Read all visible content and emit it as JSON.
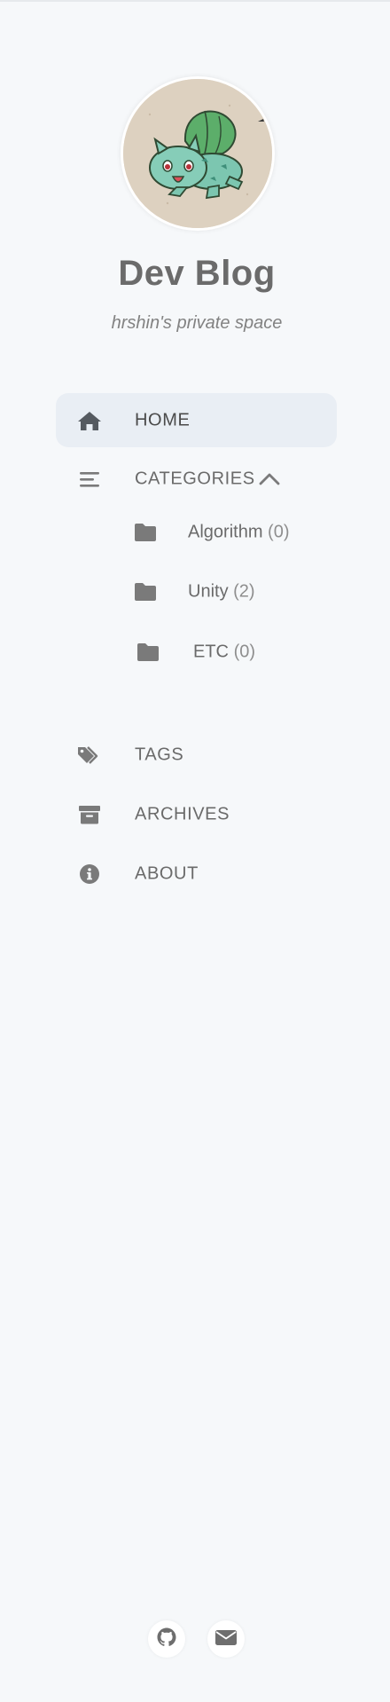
{
  "site": {
    "title": "Dev Blog",
    "subtitle": "hrshin's private space"
  },
  "nav": {
    "home": {
      "label": "HOME",
      "icon": "home-icon",
      "active": true
    },
    "categories": {
      "label": "CATEGORIES",
      "icon": "bars-icon",
      "expanded": true,
      "items": [
        {
          "name": "Algorithm",
          "count": "(0)",
          "icon": "folder-icon"
        },
        {
          "name": "Unity",
          "count": "(2)",
          "icon": "folder-icon"
        },
        {
          "name": "ETC",
          "count": "(0)",
          "icon": "folder-icon"
        }
      ]
    },
    "tags": {
      "label": "TAGS",
      "icon": "tags-icon"
    },
    "archives": {
      "label": "ARCHIVES",
      "icon": "archive-icon"
    },
    "about": {
      "label": "ABOUT",
      "icon": "info-circle-icon"
    }
  },
  "social": [
    {
      "icon": "github-icon"
    },
    {
      "icon": "envelope-icon"
    }
  ],
  "colors": {
    "background": "#f6f8fa",
    "active_item": "#e9eef4",
    "text": "#6a6a6a",
    "icon": "#7a7a7a"
  }
}
